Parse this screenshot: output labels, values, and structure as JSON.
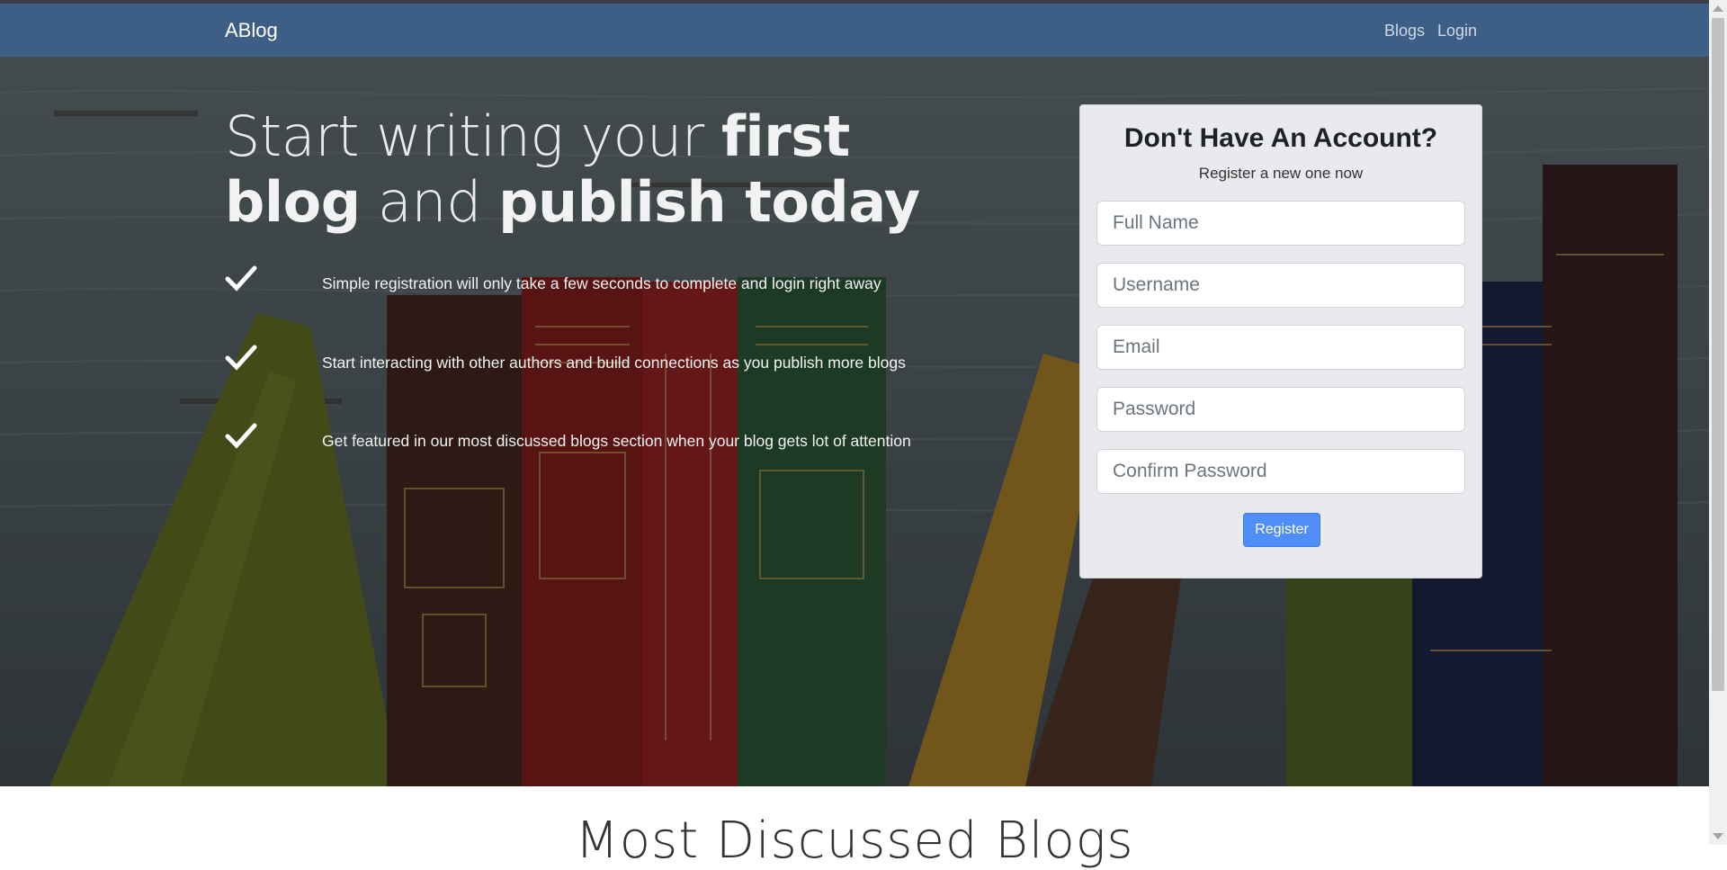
{
  "navbar": {
    "brand": "ABlog",
    "links": [
      "Blogs",
      "Login"
    ]
  },
  "hero": {
    "headline": {
      "part1": "Start writing your ",
      "bold1": "first blog",
      "part2": " and ",
      "bold2": "publish today"
    },
    "features": [
      "Simple registration will only take a few seconds to complete and login right away",
      "Start interacting with other authors and build connections as you publish more blogs",
      "Get featured in our most discussed blogs section when your blog gets lot of attention"
    ]
  },
  "register_card": {
    "title": "Don't Have An Account?",
    "subtitle": "Register a new one now",
    "fields": {
      "full_name": "Full Name",
      "username": "Username",
      "email": "Email",
      "password": "Password",
      "confirm_password": "Confirm Password"
    },
    "button_label": "Register"
  },
  "section": {
    "title": "Most Discussed Blogs"
  },
  "colors": {
    "navbar": "#3d5f85",
    "accent": "#4f8ef7",
    "card_bg": "#e9eaed"
  }
}
